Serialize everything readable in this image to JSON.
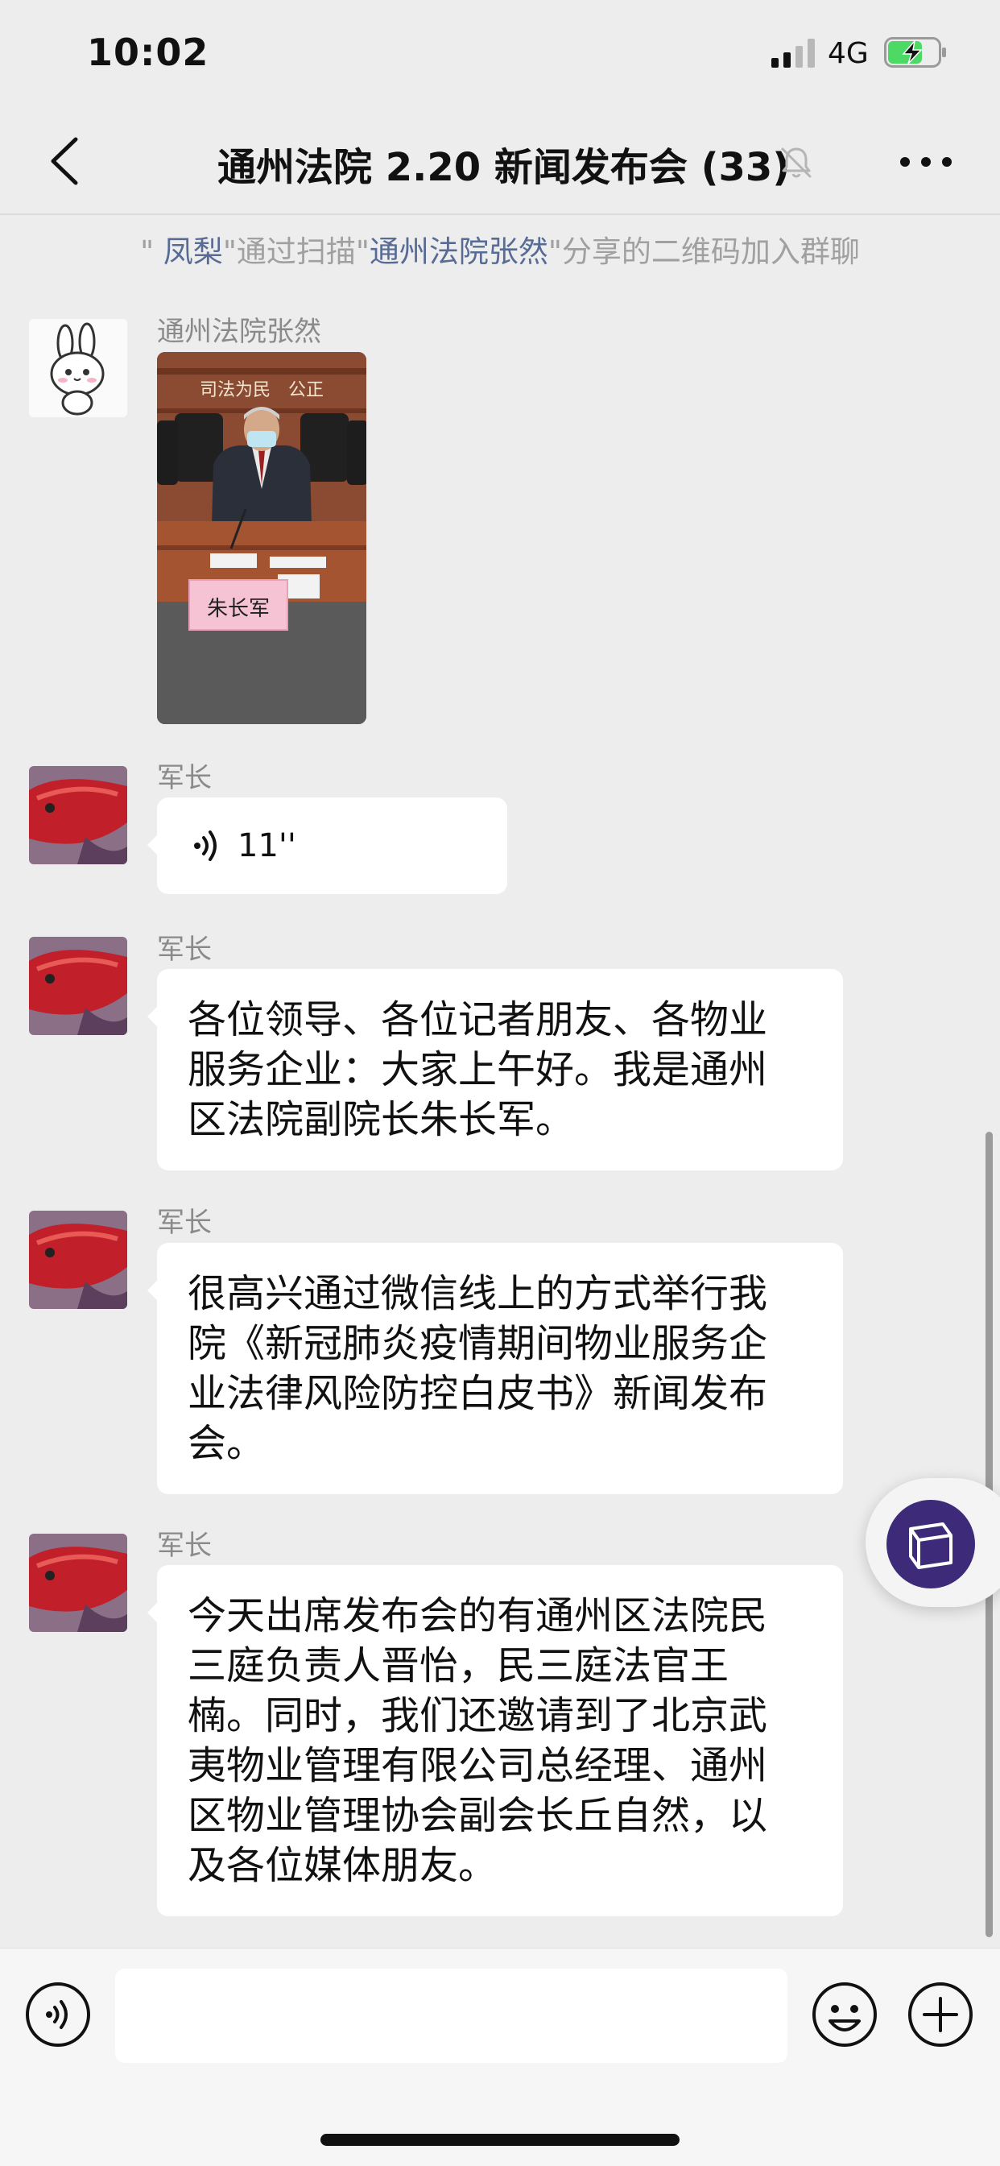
{
  "status_bar": {
    "time": "10:02",
    "network": "4G",
    "signal_icon": "signal-bars-icon",
    "battery_icon": "battery-charging-icon"
  },
  "nav": {
    "back_icon": "chevron-left-icon",
    "title": "通州法院 2.20 新闻发布会 (33)",
    "mute_icon": "bell-muted-icon",
    "more_icon": "more-dots-icon"
  },
  "system_message": {
    "q1": "\" ",
    "name1": "凤梨",
    "part2": "\"通过扫描\"",
    "name2": "通州法院张然",
    "part3": "\"分享的二维码加入群聊"
  },
  "messages": [
    {
      "sender": "通州法院张然",
      "type": "image",
      "image_sign_text": "司法为民　公正",
      "nameplate": "朱长军"
    },
    {
      "sender": "军长",
      "type": "voice",
      "duration": "11''"
    },
    {
      "sender": "军长",
      "type": "text",
      "lines": [
        "各位领导、各位记者朋友、各物业",
        "服务企业：大家上午好。我是通州",
        "区法院副院长朱长军。"
      ]
    },
    {
      "sender": "军长",
      "type": "text",
      "lines": [
        "很高兴通过微信线上的方式举行我",
        "院《新冠肺炎疫情期间物业服务企",
        "业法律风险防控白皮书》新闻发布",
        "会。"
      ]
    },
    {
      "sender": "军长",
      "type": "text",
      "lines": [
        "今天出席发布会的有通州区法院民",
        "三庭负责人晋怡，民三庭法官王",
        "楠。同时，我们还邀请到了北京武",
        "夷物业管理有限公司总经理、通州",
        "区物业管理协会副会长丘自然，以",
        "及各位媒体朋友。"
      ]
    }
  ],
  "input_bar": {
    "voice_icon": "voice-input-icon",
    "text_value": "",
    "emoji_icon": "emoji-smile-icon",
    "plus_icon": "plus-circle-icon"
  },
  "colors": {
    "background": "#ededed",
    "bubble": "#ffffff",
    "link_name": "#576b95",
    "system_text": "#a0a0a0"
  }
}
